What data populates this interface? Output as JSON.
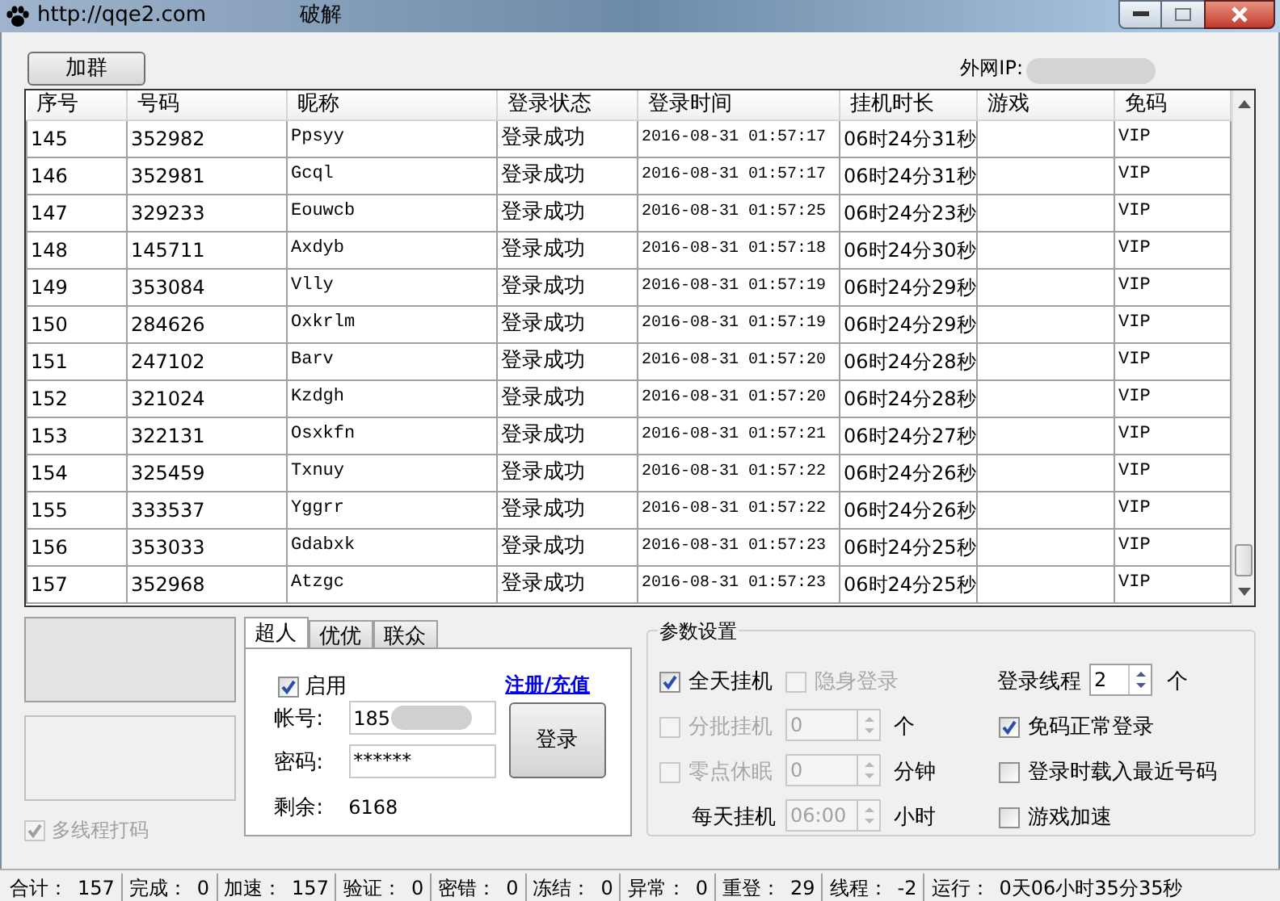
{
  "window": {
    "title": "http://qqe2.com",
    "caption": "破解"
  },
  "toolbar": {
    "add_group_button": "加群",
    "ip_label": "外网IP:"
  },
  "table": {
    "columns": [
      "序号",
      "号码",
      "昵称",
      "登录状态",
      "登录时间",
      "挂机时长",
      "游戏",
      "免码"
    ],
    "rows": [
      [
        "145",
        "352982",
        "Ppsyy",
        "登录成功",
        "2016-08-31 01:57:17",
        "06时24分31秒",
        "",
        "VIP"
      ],
      [
        "146",
        "352981",
        "Gcql",
        "登录成功",
        "2016-08-31 01:57:17",
        "06时24分31秒",
        "",
        "VIP"
      ],
      [
        "147",
        "329233",
        "Eouwcb",
        "登录成功",
        "2016-08-31 01:57:25",
        "06时24分23秒",
        "",
        "VIP"
      ],
      [
        "148",
        "145711",
        "Axdyb",
        "登录成功",
        "2016-08-31 01:57:18",
        "06时24分30秒",
        "",
        "VIP"
      ],
      [
        "149",
        "353084",
        "Vlly",
        "登录成功",
        "2016-08-31 01:57:19",
        "06时24分29秒",
        "",
        "VIP"
      ],
      [
        "150",
        "284626",
        "Oxkrlm",
        "登录成功",
        "2016-08-31 01:57:19",
        "06时24分29秒",
        "",
        "VIP"
      ],
      [
        "151",
        "247102",
        "Barv",
        "登录成功",
        "2016-08-31 01:57:20",
        "06时24分28秒",
        "",
        "VIP"
      ],
      [
        "152",
        "321024",
        "Kzdgh",
        "登录成功",
        "2016-08-31 01:57:20",
        "06时24分28秒",
        "",
        "VIP"
      ],
      [
        "153",
        "322131",
        "Osxkfn",
        "登录成功",
        "2016-08-31 01:57:21",
        "06时24分27秒",
        "",
        "VIP"
      ],
      [
        "154",
        "325459",
        "Txnuy",
        "登录成功",
        "2016-08-31 01:57:22",
        "06时24分26秒",
        "",
        "VIP"
      ],
      [
        "155",
        "333537",
        "Yggrr",
        "登录成功",
        "2016-08-31 01:57:22",
        "06时24分26秒",
        "",
        "VIP"
      ],
      [
        "156",
        "353033",
        "Gdabxk",
        "登录成功",
        "2016-08-31 01:57:23",
        "06时24分25秒",
        "",
        "VIP"
      ],
      [
        "157",
        "352968",
        "Atzgc",
        "登录成功",
        "2016-08-31 01:57:23",
        "06时24分25秒",
        "",
        "VIP"
      ]
    ]
  },
  "multithread_captcha": {
    "label": "多线程打码",
    "checked": true,
    "disabled": true
  },
  "tabs": [
    {
      "label": "超人",
      "selected": true
    },
    {
      "label": "优优",
      "selected": false
    },
    {
      "label": "联众",
      "selected": false
    }
  ],
  "login_panel": {
    "enable": {
      "label": "启用",
      "checked": true
    },
    "register_link": "注册/充值",
    "account_label": "帐号:",
    "account_value": "185",
    "password_label": "密码:",
    "password_value": "******",
    "login_button": "登录",
    "remaining_label": "剩余:",
    "remaining_value": "6168"
  },
  "settings": {
    "title": "参数设置",
    "all_day": {
      "label": "全天挂机",
      "checked": true,
      "disabled": false
    },
    "stealth": {
      "label": "隐身登录",
      "checked": false,
      "disabled": true
    },
    "batch": {
      "label": "分批挂机",
      "checked": false,
      "disabled": true,
      "value": "0",
      "unit": "个"
    },
    "midnight_sleep": {
      "label": "零点休眠",
      "checked": false,
      "disabled": true,
      "value": "0",
      "unit": "分钟"
    },
    "daily": {
      "label": "每天挂机",
      "value": "06:00",
      "unit": "小时"
    },
    "threads": {
      "label": "登录线程",
      "value": "2",
      "unit": "个"
    },
    "right_options": [
      {
        "label": "免码正常登录",
        "checked": true
      },
      {
        "label": "登录时载入最近号码",
        "checked": false
      },
      {
        "label": "游戏加速",
        "checked": false
      }
    ]
  },
  "status_bar": [
    {
      "label": "合计：",
      "value": "157"
    },
    {
      "label": "完成：",
      "value": "0"
    },
    {
      "label": "加速：",
      "value": "157"
    },
    {
      "label": "验证：",
      "value": "0"
    },
    {
      "label": "密错：",
      "value": "0"
    },
    {
      "label": "冻结：",
      "value": "0"
    },
    {
      "label": "异常：",
      "value": "0"
    },
    {
      "label": "重登：",
      "value": "29"
    },
    {
      "label": "线程：",
      "value": "-2"
    },
    {
      "label": "运行：",
      "value": "0天06小时35分35秒"
    }
  ]
}
